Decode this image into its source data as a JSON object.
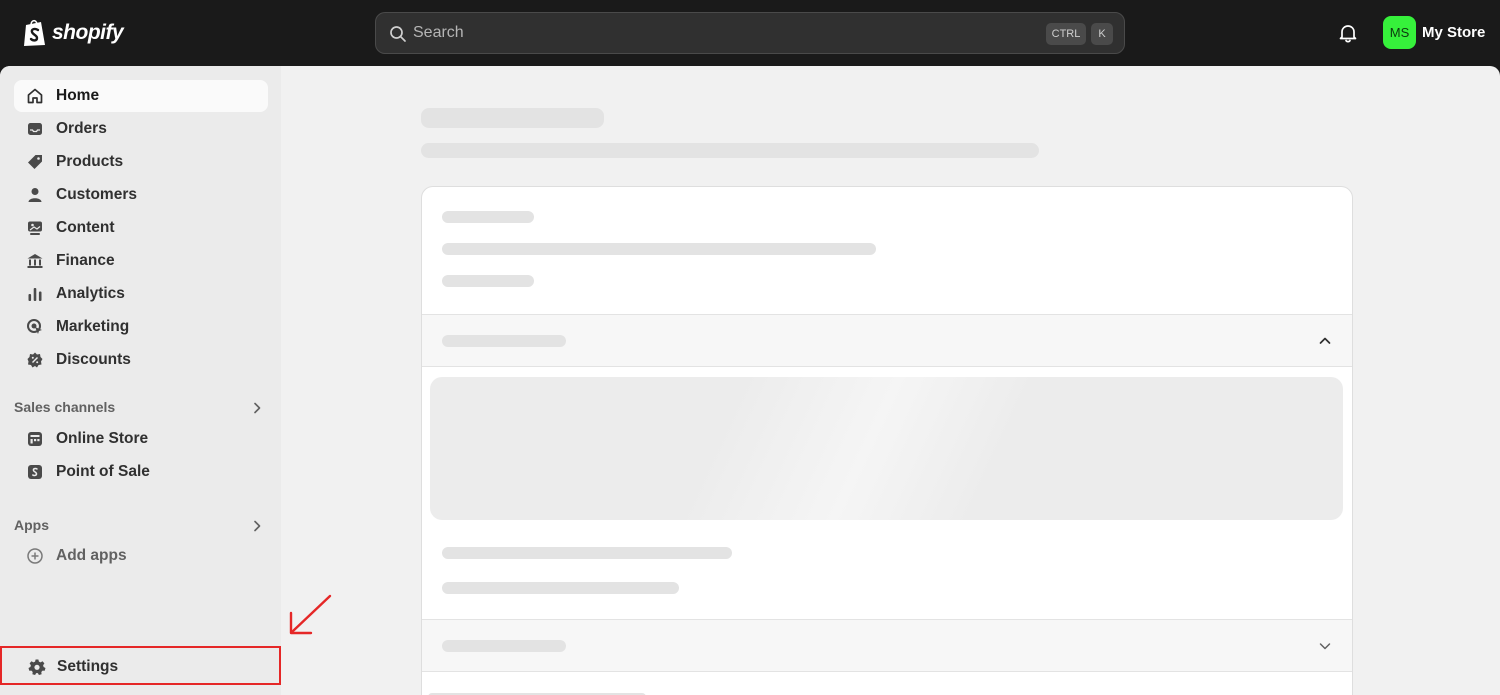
{
  "topbar": {
    "brand": "shopify",
    "search": {
      "placeholder": "Search",
      "shortcut_mod": "CTRL",
      "shortcut_key": "K"
    },
    "store": {
      "initials": "MS",
      "name": "My Store",
      "avatar_color": "#36f13b"
    }
  },
  "sidebar": {
    "main_items": [
      {
        "label": "Home",
        "icon": "home-icon",
        "active": true
      },
      {
        "label": "Orders",
        "icon": "inbox-icon"
      },
      {
        "label": "Products",
        "icon": "tag-icon"
      },
      {
        "label": "Customers",
        "icon": "person-icon"
      },
      {
        "label": "Content",
        "icon": "content-icon"
      },
      {
        "label": "Finance",
        "icon": "bank-icon"
      },
      {
        "label": "Analytics",
        "icon": "bar-chart-icon"
      },
      {
        "label": "Marketing",
        "icon": "target-icon"
      },
      {
        "label": "Discounts",
        "icon": "discount-icon"
      }
    ],
    "sales_channels": {
      "title": "Sales channels",
      "items": [
        {
          "label": "Online Store",
          "icon": "storefront-icon"
        },
        {
          "label": "Point of Sale",
          "icon": "pos-icon"
        }
      ]
    },
    "apps": {
      "title": "Apps",
      "items": [
        {
          "label": "Add apps",
          "icon": "plus-circle-icon"
        }
      ]
    },
    "settings": {
      "label": "Settings",
      "icon": "gear-icon"
    }
  },
  "colors": {
    "topbar": "#1a1a1a",
    "annotation": "#e52727",
    "sidebar": "#ebebeb",
    "canvas": "#f1f1f1"
  }
}
